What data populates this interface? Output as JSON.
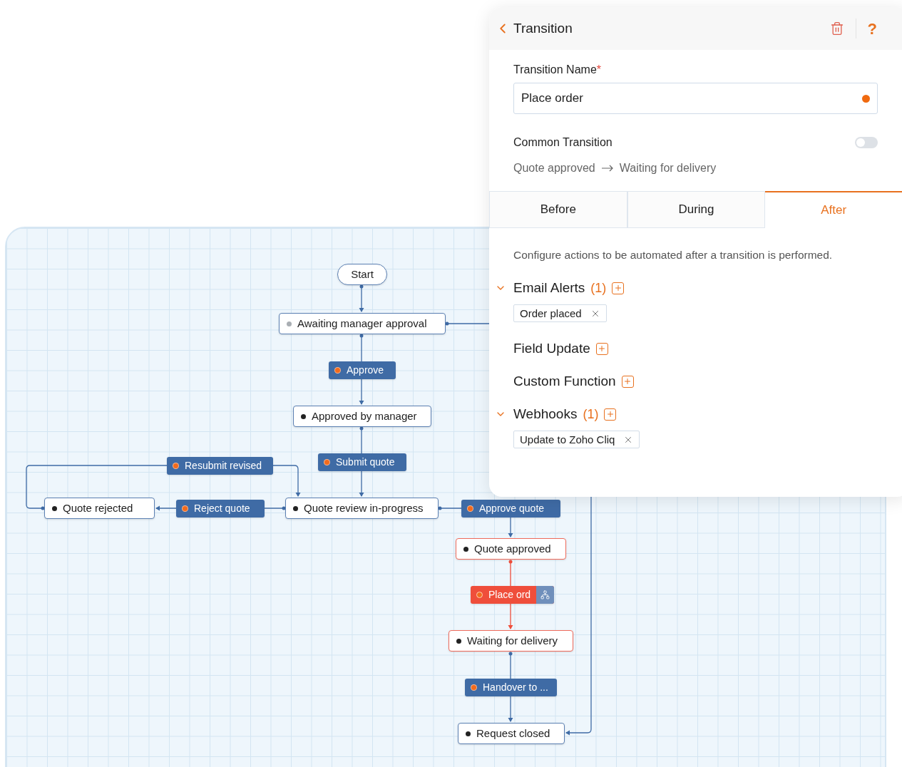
{
  "diagram": {
    "nodes": [
      {
        "kind": "start",
        "label": "Start"
      },
      {
        "kind": "state",
        "label": "Awaiting manager approval",
        "color": "#a9aeb3",
        "highlighted": false
      },
      {
        "kind": "transition",
        "label": "Approve",
        "highlighted": false
      },
      {
        "kind": "state",
        "label": "Approved by manager",
        "color": "#222222",
        "highlighted": false
      },
      {
        "kind": "transition",
        "label": "Submit quote",
        "highlighted": false
      },
      {
        "kind": "transition",
        "label": "Resubmit revised",
        "highlighted": false
      },
      {
        "kind": "state",
        "label": "Quote rejected",
        "color": "#222222",
        "highlighted": false
      },
      {
        "kind": "transition",
        "label": "Reject quote",
        "highlighted": false
      },
      {
        "kind": "state",
        "label": "Quote review in-progress",
        "color": "#222222",
        "highlighted": false
      },
      {
        "kind": "transition",
        "label": "Approve quote",
        "highlighted": false
      },
      {
        "kind": "state",
        "label": "Quote approved",
        "color": "#222222",
        "highlighted": true
      },
      {
        "kind": "transition",
        "label": "Place ord",
        "highlighted": true
      },
      {
        "kind": "state",
        "label": "Waiting for delivery",
        "color": "#222222",
        "highlighted": true
      },
      {
        "kind": "transition",
        "label": "Handover to ...",
        "highlighted": false
      },
      {
        "kind": "state",
        "label": "Request closed",
        "color": "#222222",
        "highlighted": false
      }
    ]
  },
  "panel": {
    "title": "Transition",
    "help": "?",
    "name_field": {
      "label": "Transition Name",
      "required_mark": "*",
      "value": "Place order"
    },
    "common_transition": {
      "label": "Common Transition",
      "on": false
    },
    "path": {
      "from": "Quote approved",
      "to": "Waiting for delivery"
    },
    "tabs": [
      {
        "label": "Before",
        "selected": false
      },
      {
        "label": "During",
        "selected": false
      },
      {
        "label": "After",
        "selected": true
      }
    ],
    "description": "Configure actions to be automated after a transition is performed.",
    "sections": [
      {
        "title": "Email Alerts",
        "count": "(1)",
        "expanded": true,
        "items": [
          "Order placed"
        ]
      },
      {
        "title": "Field Update"
      },
      {
        "title": "Custom Function"
      },
      {
        "title": "Webhooks",
        "count": "(1)",
        "expanded": true,
        "items": [
          "Update to Zoho Cliq"
        ]
      }
    ]
  }
}
